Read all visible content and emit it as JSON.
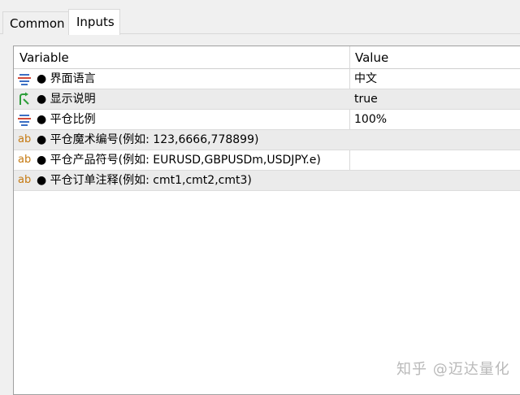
{
  "tabs": [
    {
      "label": "Common"
    },
    {
      "label": "Inputs"
    }
  ],
  "table": {
    "columns": [
      "Variable",
      "Value"
    ],
    "rows": [
      {
        "icon": "enum-icon",
        "name": "● 界面语言",
        "value": "中文"
      },
      {
        "icon": "bool-icon",
        "name": "● 显示说明",
        "value": "true"
      },
      {
        "icon": "enum-icon",
        "name": "● 平仓比例",
        "value": "100%"
      },
      {
        "icon": "string-icon",
        "icon_text": "ab",
        "name": "● 平仓魔术编号(例如: 123,6666,778899)",
        "value": ""
      },
      {
        "icon": "string-icon",
        "icon_text": "ab",
        "name": "● 平仓产品符号(例如: EURUSD,GBPUSDm,USDJPY.e)",
        "value": ""
      },
      {
        "icon": "string-icon",
        "icon_text": "ab",
        "name": "● 平仓订单注释(例如: cmt1,cmt2,cmt3)",
        "value": ""
      }
    ]
  },
  "colors": {
    "string_icon": "#c57a12",
    "enum_icon_blue": "#3b6fc4",
    "enum_icon_red": "#d04a3a",
    "bool_icon": "#2e9e3a",
    "alt_row": "#ebebeb"
  },
  "watermark": "知乎 @迈达量化"
}
